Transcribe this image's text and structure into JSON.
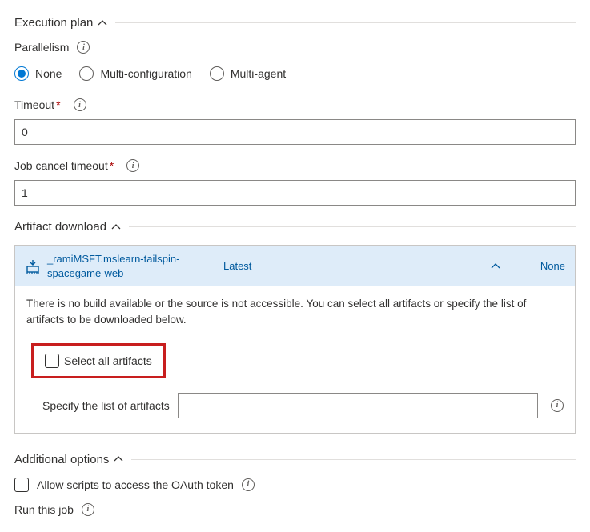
{
  "execution_plan": {
    "title": "Execution plan",
    "parallelism_label": "Parallelism",
    "radios": {
      "none": "None",
      "multi_config": "Multi-configuration",
      "multi_agent": "Multi-agent",
      "selected": "none"
    },
    "timeout_label": "Timeout",
    "timeout_value": "0",
    "cancel_label": "Job cancel timeout",
    "cancel_value": "1"
  },
  "artifact_download": {
    "title": "Artifact download",
    "source_name": "_ramiMSFT.mslearn-tailspin-spacegame-web",
    "latest_label": "Latest",
    "none_label": "None",
    "message": "There is no build available or the source is not accessible. You can select all artifacts or specify the list of artifacts to be downloaded below.",
    "select_all_label": "Select all artifacts",
    "specify_label": "Specify the list of artifacts",
    "specify_value": ""
  },
  "additional_options": {
    "title": "Additional options",
    "allow_scripts_label": "Allow scripts to access the OAuth token",
    "run_label": "Run this job"
  }
}
